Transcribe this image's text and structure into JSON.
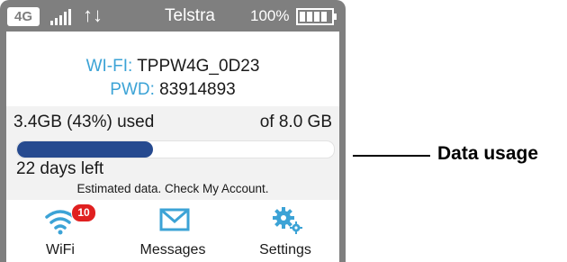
{
  "status_bar": {
    "network_badge": "4G",
    "carrier": "Telstra",
    "battery_percent": "100%",
    "signal_icon": "signal-bars-icon",
    "transfer_icon": "up-down-arrows-icon",
    "battery_icon": "battery-full-icon",
    "up_down_glyph": "↑↓"
  },
  "wifi": {
    "ssid_label": "WI-FI:",
    "ssid_value": "TPPW4G_0D23",
    "password_label": "PWD:",
    "password_value": "83914893"
  },
  "usage": {
    "used_text": "3.4GB (43%) used",
    "total_text": "of 8.0 GB",
    "used_fraction": 0.43,
    "days_left": "22 days left",
    "estimate_note": "Estimated data. Check My Account."
  },
  "nav": {
    "items": [
      {
        "label": "WiFi",
        "icon": "wifi-icon",
        "badge": "10"
      },
      {
        "label": "Messages",
        "icon": "envelope-icon"
      },
      {
        "label": "Settings",
        "icon": "gears-icon"
      }
    ]
  },
  "callout": {
    "label": "Data usage"
  },
  "colors": {
    "frame": "#7f7f7f",
    "accent_blue": "#3ca3d6",
    "bar_fill": "#264a8f",
    "badge_red": "#e02020"
  }
}
